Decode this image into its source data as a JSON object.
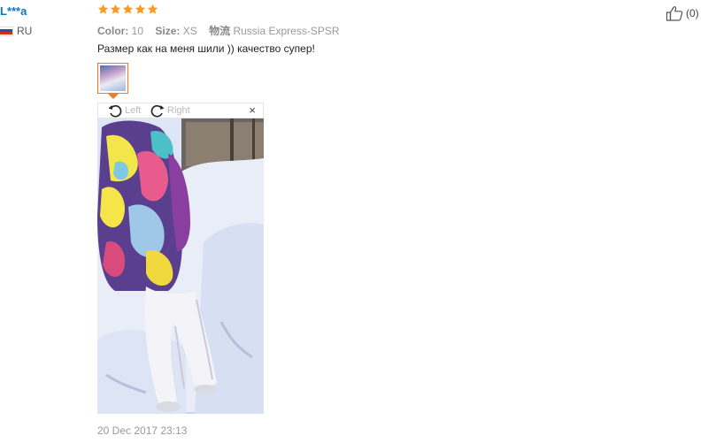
{
  "reviewer": {
    "name": "L***a",
    "country": "RU",
    "flag_colors": [
      "#ffffff",
      "#1c57a5",
      "#d52b1e"
    ]
  },
  "review": {
    "rating": 5,
    "star_color": "#f79a1e",
    "color_label": "Color:",
    "color_value": "10",
    "size_label": "Size:",
    "size_value": "XS",
    "shipping_label": "物流",
    "shipping_value": "Russia Express-SPSR",
    "text": "Размер как на меня шили )) качество супер!",
    "date": "20 Dec 2017 23:13"
  },
  "helpful": {
    "count": "(0)",
    "icon": "thumbs-up-icon"
  },
  "viewer": {
    "rotate_left_label": "Left",
    "rotate_right_label": "Right",
    "close_label": "×",
    "accent": "#f07d26"
  }
}
